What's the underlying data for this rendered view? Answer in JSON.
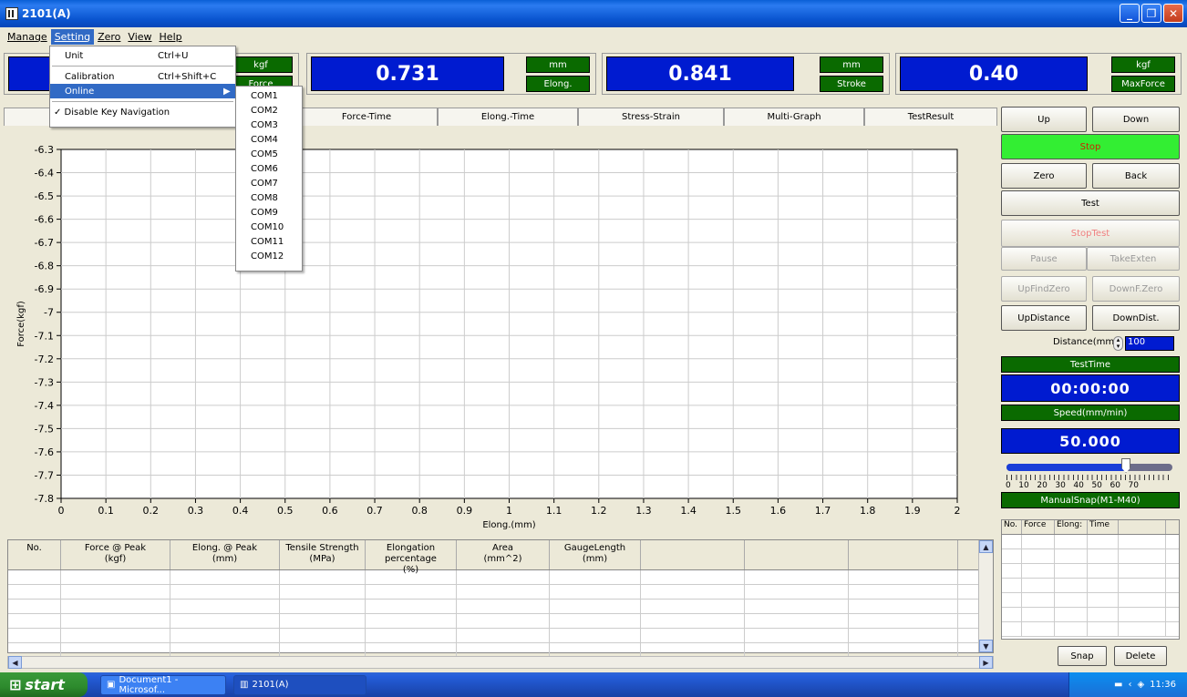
{
  "window": {
    "title": "2101(A)"
  },
  "menubar": [
    "Manage",
    "Setting",
    "Zero",
    "View",
    "Help"
  ],
  "gauges": [
    {
      "value": "",
      "unit": "kgf",
      "label": "Force"
    },
    {
      "value": "0.731",
      "unit": "mm",
      "label": "Elong."
    },
    {
      "value": "0.841",
      "unit": "mm",
      "label": "Stroke"
    },
    {
      "value": "0.40",
      "unit": "kgf",
      "label": "MaxForce"
    }
  ],
  "tabs": [
    "Force-Time",
    "Elong.-Time",
    "Stress-Strain",
    "Multi-Graph",
    "TestResult"
  ],
  "setting_menu": {
    "items": [
      {
        "label": "Unit",
        "shortcut": "Ctrl+U"
      },
      {
        "label": "Calibration",
        "shortcut": "Ctrl+Shift+C"
      },
      {
        "label": "Online",
        "shortcut": "▶"
      },
      {
        "label": "✓ Disable Key Navigation",
        "shortcut": ""
      }
    ],
    "online_submenu": [
      "COM1",
      "COM2",
      "COM3",
      "COM4",
      "COM5",
      "COM6",
      "COM7",
      "COM8",
      "COM9",
      "COM10",
      "COM11",
      "COM12"
    ]
  },
  "chart_data": {
    "type": "line",
    "xlabel": "Elong.(mm)",
    "ylabel": "Force(kgf)",
    "xlim": [
      0,
      2
    ],
    "ylim": [
      -7.8,
      -6.3
    ],
    "x_ticks": [
      "0",
      "0.1",
      "0.2",
      "0.3",
      "0.4",
      "0.5",
      "0.6",
      "0.7",
      "0.8",
      "0.9",
      "1",
      "1.1",
      "1.2",
      "1.3",
      "1.4",
      "1.5",
      "1.6",
      "1.7",
      "1.8",
      "1.9",
      "2"
    ],
    "y_ticks": [
      "-6.3",
      "-6.4",
      "-6.5",
      "-6.6",
      "-6.7",
      "-6.8",
      "-6.9",
      "-7",
      "-7.1",
      "-7.2",
      "-7.3",
      "-7.4",
      "-7.5",
      "-7.6",
      "-7.7",
      "-7.8"
    ],
    "grid": true,
    "series": []
  },
  "results_table": {
    "headers": [
      "No.",
      "Force @ Peak\n(kgf)",
      "Elong. @ Peak\n(mm)",
      "Tensile Strength\n(MPa)",
      "Elongation percentage\n(%)",
      "Area\n(mm^2)",
      "GaugeLength\n(mm)",
      "",
      "",
      ""
    ]
  },
  "controls": {
    "up": "Up",
    "down": "Down",
    "stop": "Stop",
    "zero": "Zero",
    "back": "Back",
    "test": "Test",
    "stoptest": "StopTest",
    "pause": "Pause",
    "takeexten": "TakeExten",
    "upfindzero": "UpFindZero",
    "downfzero": "DownF.Zero",
    "updistance": "UpDistance",
    "downdist": "DownDist.",
    "distance_label": "Distance(mm)",
    "distance_value": "100",
    "testtime_label": "TestTime",
    "testtime_value": "00:00:00",
    "speed_label": "Speed(mm/min)",
    "speed_value": "50.000",
    "speed_level": 0.72,
    "speed_ticks": "0   10   20   30   40   50   60   70",
    "manualsnap": "ManualSnap(M1-M40)",
    "snap": "Snap",
    "delete": "Delete"
  },
  "snap_table": {
    "headers": [
      "No.",
      "Force",
      "Elong:",
      "Time",
      ""
    ]
  },
  "taskbar": {
    "start": "start",
    "tasks": [
      "Document1 - Microsof...",
      "2101(A)"
    ],
    "clock": "11:36"
  }
}
